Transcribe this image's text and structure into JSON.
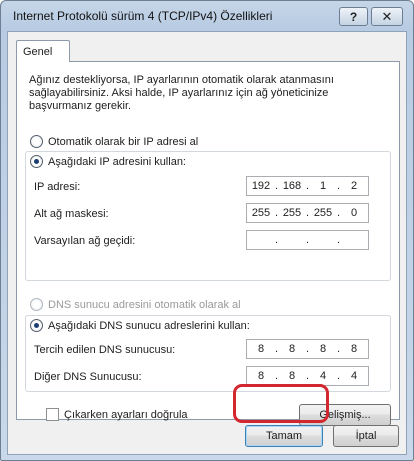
{
  "window": {
    "title": "Internet Protokolü sürüm 4 (TCP/IPv4) Özellikleri",
    "help_symbol": "?",
    "close_symbol": "✕"
  },
  "tabs": [
    {
      "label": "Genel",
      "selected": true
    }
  ],
  "description": "Ağınız destekliyorsa, IP ayarlarının otomatik olarak atanmasını sağlayabilirsiniz. Aksi halde, IP ayarlarınız için ağ yöneticinize başvurmanız gerekir.",
  "ip_section": {
    "auto_radio_label": "Otomatik olarak bir IP adresi al",
    "manual_radio_label": "Aşağıdaki IP adresini kullan:",
    "selected": "manual",
    "fields": [
      {
        "label": "IP adresi:",
        "octets": [
          "192",
          "168",
          "1",
          "2"
        ]
      },
      {
        "label": "Alt ağ maskesi:",
        "octets": [
          "255",
          "255",
          "255",
          "0"
        ]
      },
      {
        "label": "Varsayılan ağ geçidi:",
        "octets": [
          "",
          "",
          "",
          ""
        ]
      }
    ]
  },
  "dns_section": {
    "auto_radio_label": "DNS sunucu adresini otomatik olarak al",
    "auto_disabled": true,
    "manual_radio_label": "Aşağıdaki DNS sunucu adreslerini kullan:",
    "selected": "manual",
    "fields": [
      {
        "label": "Tercih edilen DNS sunucusu:",
        "octets": [
          "8",
          "8",
          "8",
          "8"
        ]
      },
      {
        "label": "Diğer DNS Sunucusu:",
        "octets": [
          "8",
          "8",
          "4",
          "4"
        ]
      }
    ]
  },
  "validate_checkbox": {
    "label": "Çıkarken ayarları doğrula",
    "checked": false
  },
  "buttons": {
    "advanced": "Gelişmiş...",
    "ok": "Tamam",
    "cancel": "İptal"
  },
  "colors": {
    "highlight": "#d3272f",
    "selection_dot": "#1b3d73"
  }
}
